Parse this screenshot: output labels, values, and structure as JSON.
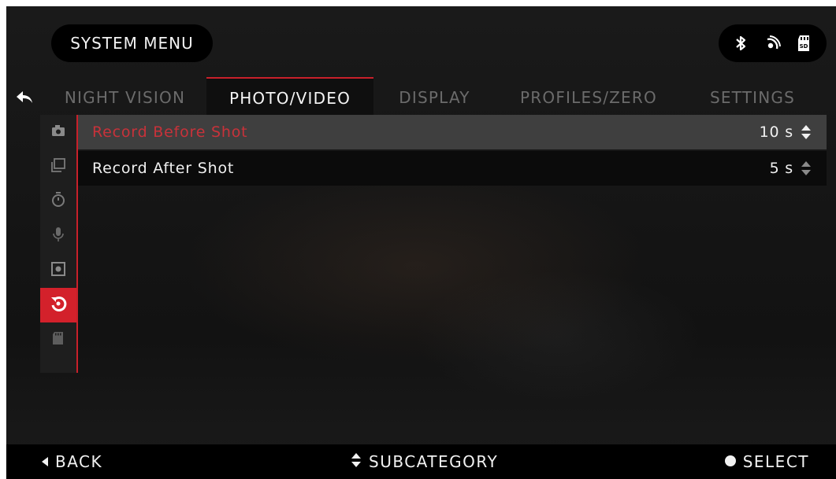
{
  "header": {
    "title": "SYSTEM MENU"
  },
  "status_icons": [
    "bluetooth-icon",
    "wifi-icon",
    "sd-card-icon"
  ],
  "tabs": [
    {
      "label": "NIGHT VISION",
      "active": false
    },
    {
      "label": "PHOTO/VIDEO",
      "active": true
    },
    {
      "label": "DISPLAY",
      "active": false
    },
    {
      "label": "PROFILES/ZERO",
      "active": false
    },
    {
      "label": "SETTINGS",
      "active": false
    }
  ],
  "sidebar": {
    "items": [
      {
        "icon": "camera-icon",
        "active": false
      },
      {
        "icon": "video-icon",
        "active": false
      },
      {
        "icon": "timer-icon",
        "active": false
      },
      {
        "icon": "microphone-icon",
        "active": false
      },
      {
        "icon": "settings-box-icon",
        "active": false
      },
      {
        "icon": "recoil-activated-icon",
        "active": true
      },
      {
        "icon": "sd-card-icon",
        "active": false
      }
    ]
  },
  "settings": [
    {
      "label": "Record Before Shot",
      "value": "10 s",
      "selected": true
    },
    {
      "label": "Record After Shot",
      "value": "5 s",
      "selected": false
    }
  ],
  "footer": {
    "back_label": "BACK",
    "subcategory_label": "SUBCATEGORY",
    "select_label": "SELECT"
  },
  "colors": {
    "accent_red": "#c8202a",
    "selected_row": "#3f3f3f",
    "inactive_tab_text": "#6b6b6b"
  }
}
